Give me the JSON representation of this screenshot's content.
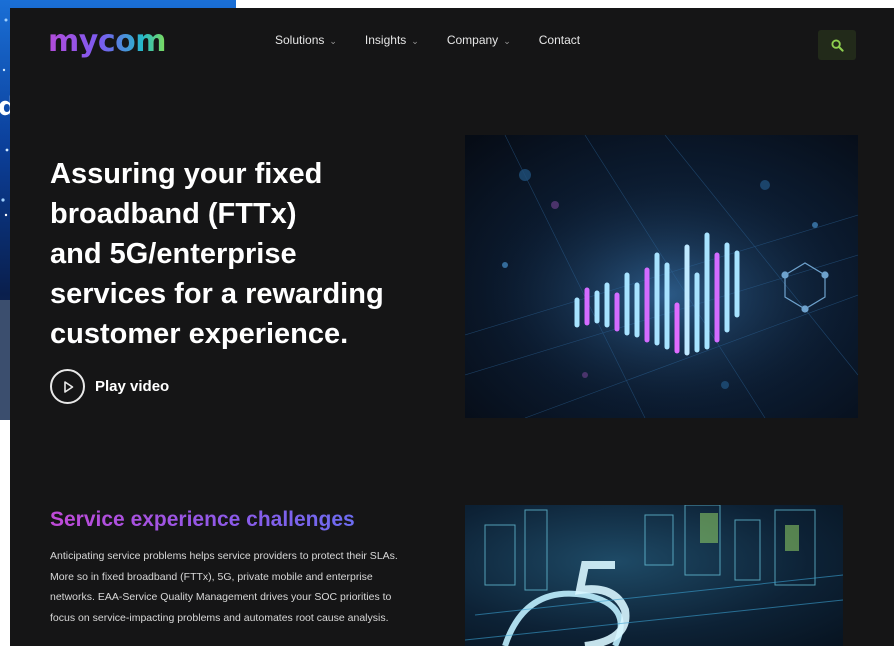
{
  "background_window": {
    "visible_letter": "d"
  },
  "header": {
    "logo": "mycom",
    "nav": [
      {
        "label": "Solutions",
        "has_dropdown": true
      },
      {
        "label": "Insights",
        "has_dropdown": true
      },
      {
        "label": "Company",
        "has_dropdown": true
      },
      {
        "label": "Contact",
        "has_dropdown": false
      }
    ],
    "search_icon": "search-icon"
  },
  "hero": {
    "title_lines": [
      "Assuring your fixed",
      "broadband (FTTx)",
      "and 5G/enterprise",
      "services for a rewarding",
      "customer experience."
    ],
    "play_label": "Play video",
    "play_icon": "play-icon"
  },
  "section": {
    "title": "Service experience challenges",
    "body_lines": [
      "Anticipating service problems helps service providers to protect their SLAs.",
      "More so in fixed broadband (FTTx), 5G, private mobile and enterprise",
      "networks. EAA-Service Quality Management drives your SOC priorities to",
      "focus on service-impacting problems and automates root cause analysis."
    ]
  },
  "colors": {
    "page_bg": "#151516",
    "accent_purple": "#c04ad8",
    "accent_green": "#8fd14f",
    "search_bg": "#222a1a"
  }
}
